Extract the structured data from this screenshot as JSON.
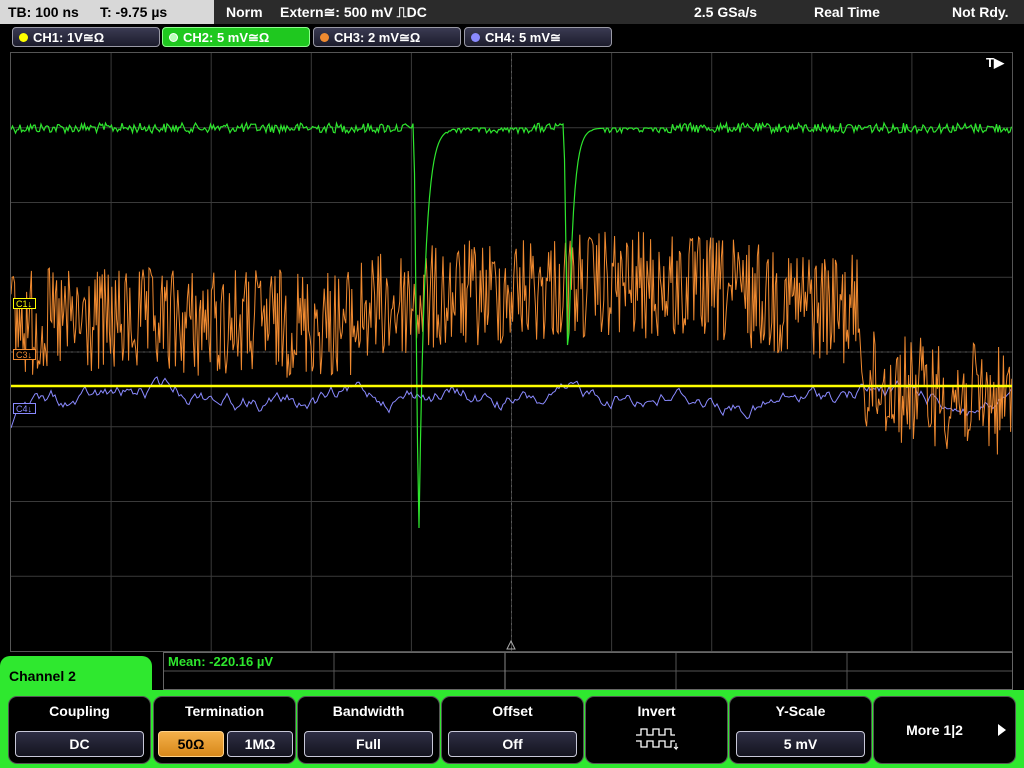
{
  "status_bar": {
    "timebase": "TB: 100 ns",
    "trigger_time": "T: -9.75 µs",
    "trigger_mode": "Norm",
    "trigger_source": "Extern≅: 500 mV ⎍DC",
    "sample_rate": "2.5 GSa/s",
    "acq_mode": "Real Time",
    "ready_state": "Not Rdy."
  },
  "channels": [
    {
      "label": "CH1: 1V≅Ω",
      "color": "#ffff00"
    },
    {
      "label": "CH2: 5 mV≅Ω",
      "color": "#2ee62e",
      "active": true
    },
    {
      "label": "CH3: 2 mV≅Ω",
      "color": "#f08a30"
    },
    {
      "label": "CH4: 5 mV≅",
      "color": "#8a8aff"
    }
  ],
  "screen": {
    "trigger_marker": "T▶",
    "markers": {
      "ch1": "C1↓",
      "ch3": "C3↓",
      "ch4": "C4↓"
    }
  },
  "measurement": {
    "mean": "Mean: -220.16 µV"
  },
  "menu": {
    "title": "Channel 2"
  },
  "softkeys": {
    "coupling": {
      "title": "Coupling",
      "value": "DC"
    },
    "termination": {
      "title": "Termination",
      "opt_50": "50Ω",
      "opt_1m": "1MΩ",
      "selected": "50Ω"
    },
    "bandwidth": {
      "title": "Bandwidth",
      "value": "Full"
    },
    "offset": {
      "title": "Offset",
      "value": "Off"
    },
    "invert": {
      "title": "Invert",
      "icon": "invert-waveform-icon"
    },
    "y_scale": {
      "title": "Y-Scale",
      "value": "5 mV"
    },
    "more": {
      "label": "More 1|2",
      "icon": "chevron-right-icon"
    }
  },
  "colors": {
    "ch1": "#ffff00",
    "ch2": "#2ee62e",
    "ch3": "#f08a30",
    "ch4": "#8a8aff",
    "menu_accent": "#2fe82f",
    "selected_option": "#e89a30"
  }
}
